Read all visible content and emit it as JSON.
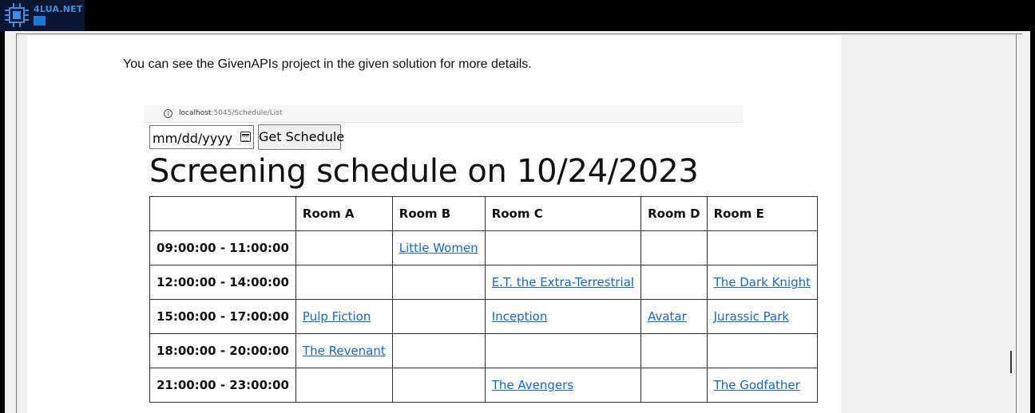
{
  "logo": {
    "text": "4LUA.NET"
  },
  "intro_text": "You can see the GivenAPIs project in the given solution for more details.",
  "browser": {
    "host": "localhost",
    "path": ":5045/Schedule/List",
    "info_icon": "info-icon"
  },
  "date_input": {
    "placeholder": "mm/dd/yyyy",
    "icon": "calendar-icon"
  },
  "get_button_label": "Get Schedule",
  "heading": "Screening schedule on 10/24/2023",
  "table": {
    "headers": [
      "",
      "Room A",
      "Room B",
      "Room C",
      "Room D",
      "Room E"
    ],
    "rows": [
      {
        "time": "09:00:00 - 11:00:00",
        "cells": [
          "",
          "Little Women",
          "",
          "",
          ""
        ]
      },
      {
        "time": "12:00:00 - 14:00:00",
        "cells": [
          "",
          "",
          "E.T. the Extra-Terrestrial",
          "",
          "The Dark Knight"
        ]
      },
      {
        "time": "15:00:00 - 17:00:00",
        "cells": [
          "Pulp Fiction",
          "",
          "Inception",
          "Avatar",
          "Jurassic Park"
        ]
      },
      {
        "time": "18:00:00 - 20:00:00",
        "cells": [
          "The Revenant",
          "",
          "",
          "",
          ""
        ]
      },
      {
        "time": "21:00:00 - 23:00:00",
        "cells": [
          "",
          "",
          "The Avengers",
          "",
          "The Godfather"
        ]
      }
    ]
  },
  "colors": {
    "link": "#1a66c7",
    "page_bg": "#ffffff",
    "outer_bg": "#000000"
  }
}
